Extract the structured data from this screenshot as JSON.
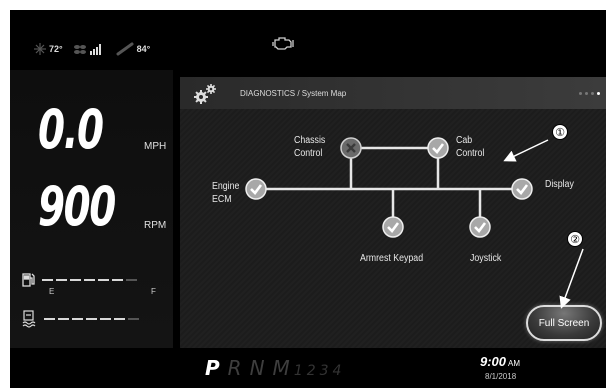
{
  "status": {
    "inside_temp": "72°",
    "outside_temp": "84°",
    "icons": [
      "fan-icon",
      "signal-icon",
      "thermometer-icon",
      "check-engine-icon"
    ]
  },
  "gauges": {
    "speed_value": "0.0",
    "speed_unit": "MPH",
    "rpm_value": "900",
    "rpm_unit": "RPM",
    "fuel_empty": "E",
    "fuel_full": "F",
    "fuel_level_fraction": 0.85,
    "def_level_fraction": 0.85
  },
  "diagnostics": {
    "title": "DIAGNOSTICS / System Map",
    "page_dots": 4,
    "active_page": 4,
    "nodes": {
      "chassis": {
        "label_1": "Chassis",
        "label_2": "Control",
        "status": "error"
      },
      "cab": {
        "label_1": "Cab",
        "label_2": "Control",
        "status": "ok"
      },
      "engine": {
        "label_1": "Engine",
        "label_2": "ECM",
        "status": "ok"
      },
      "display": {
        "label": "Display",
        "status": "ok"
      },
      "armrest": {
        "label": "Armrest Keypad",
        "status": "ok"
      },
      "joystick": {
        "label": "Joystick",
        "status": "ok"
      }
    },
    "full_screen_label": "Full Screen"
  },
  "transmission": {
    "selected": "P",
    "others": [
      "R",
      "N",
      "M"
    ],
    "gears": "1234"
  },
  "clock": {
    "time": "9:00",
    "ampm": "AM",
    "date": "8/1/2018"
  },
  "annotations": {
    "one": "①",
    "two": "②"
  },
  "colors": {
    "background": "#000000",
    "panel": "#1c1c1c",
    "ok_node": "#9a9a9a",
    "error_node": "#5a5a5a"
  }
}
